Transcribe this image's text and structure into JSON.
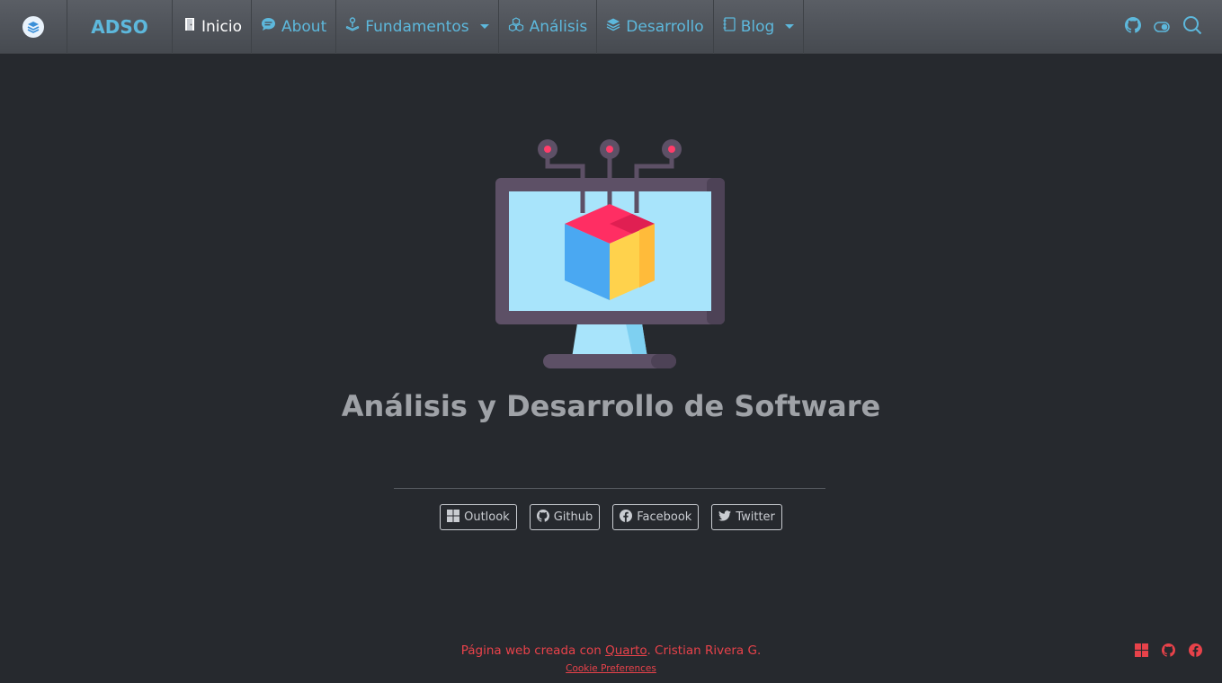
{
  "navbar": {
    "brand": "ADSO",
    "items": [
      {
        "label": "Inicio",
        "icon": "door-icon",
        "active": true
      },
      {
        "label": "About",
        "icon": "chat-icon"
      },
      {
        "label": "Fundamentos",
        "icon": "joystick-icon",
        "dropdown": true
      },
      {
        "label": "Análisis",
        "icon": "boxes-icon"
      },
      {
        "label": "Desarrollo",
        "icon": "layers-icon"
      },
      {
        "label": "Blog",
        "icon": "journal-icon",
        "dropdown": true
      }
    ],
    "right_icons": [
      "github-icon",
      "toggle-icon",
      "search-icon"
    ]
  },
  "main": {
    "title": "Análisis y Desarrollo de Software",
    "links": [
      {
        "label": "Outlook",
        "icon": "windows-icon"
      },
      {
        "label": "Github",
        "icon": "github-icon"
      },
      {
        "label": "Facebook",
        "icon": "facebook-icon"
      },
      {
        "label": "Twitter",
        "icon": "twitter-icon"
      }
    ]
  },
  "footer": {
    "prefix": "Página web creada con ",
    "link": "Quarto",
    "suffix": ". Cristian Rivera G.",
    "cookie": "Cookie Preferences",
    "icons": [
      "windows-icon",
      "github-icon",
      "facebook-icon"
    ]
  },
  "colors": {
    "background": "#26292e",
    "accent": "#5db8dc",
    "footer": "#e8424a"
  }
}
